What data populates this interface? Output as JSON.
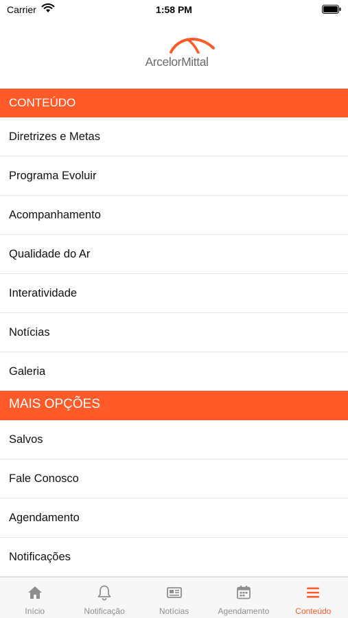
{
  "status_bar": {
    "carrier": "Carrier",
    "time": "1:58 PM"
  },
  "logo": {
    "text": "ArcelorMittal",
    "brand_color": "#ff5a28"
  },
  "sections": {
    "content": {
      "title": "CONTEÚDO",
      "items": [
        "Diretrizes e Metas",
        "Programa Evoluir",
        "Acompanhamento",
        "Qualidade do Ar",
        "Interatividade",
        "Notícias",
        "Galeria"
      ]
    },
    "more": {
      "title": "MAIS OPÇÕES",
      "items": [
        "Salvos",
        "Fale Conosco",
        "Agendamento",
        "Notificações"
      ]
    }
  },
  "tab_bar": {
    "active_index": 4,
    "tabs": [
      {
        "label": "Início",
        "icon": "home-icon"
      },
      {
        "label": "Notificação",
        "icon": "bell-icon"
      },
      {
        "label": "Notícias",
        "icon": "newspaper-icon"
      },
      {
        "label": "Agendamento",
        "icon": "calendar-icon"
      },
      {
        "label": "Conteúdo",
        "icon": "menu-icon"
      }
    ]
  },
  "colors": {
    "accent": "#ff5a28",
    "tab_inactive": "#8e8e8e",
    "tab_active": "#ff5a28"
  }
}
